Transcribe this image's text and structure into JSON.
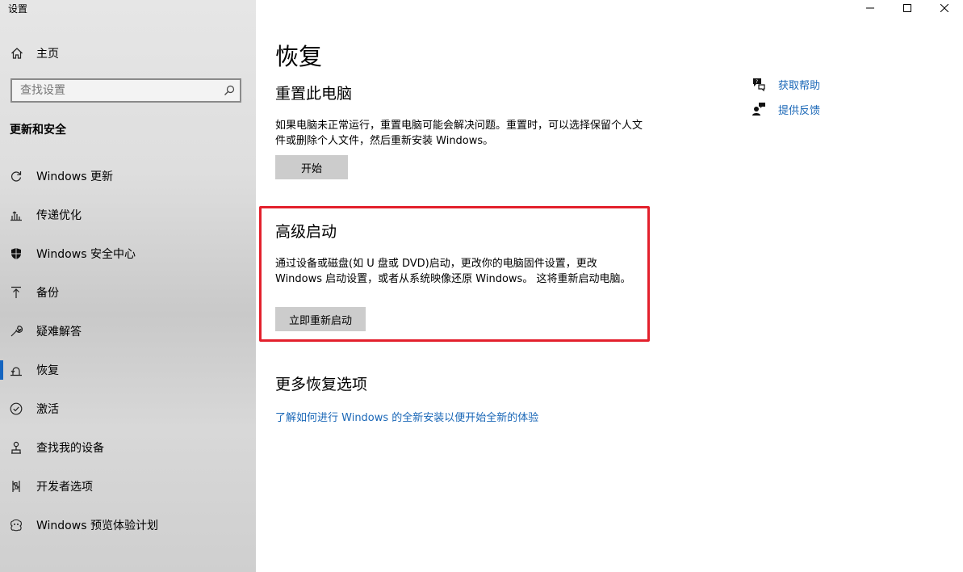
{
  "app_title": "设置",
  "window_controls": {
    "minimize": "—",
    "maximize": "☐",
    "close": "✕"
  },
  "sidebar": {
    "home_label": "主页",
    "search_placeholder": "查找设置",
    "section_title": "更新和安全",
    "items": [
      {
        "label": "Windows 更新",
        "icon": "refresh-icon",
        "active": false
      },
      {
        "label": "传递优化",
        "icon": "delivery-optimization-icon",
        "active": false
      },
      {
        "label": "Windows 安全中心",
        "icon": "shield-icon",
        "active": false
      },
      {
        "label": "备份",
        "icon": "backup-icon",
        "active": false
      },
      {
        "label": "疑难解答",
        "icon": "wrench-icon",
        "active": false
      },
      {
        "label": "恢复",
        "icon": "recovery-icon",
        "active": true
      },
      {
        "label": "激活",
        "icon": "check-circle-icon",
        "active": false
      },
      {
        "label": "查找我的设备",
        "icon": "find-device-icon",
        "active": false
      },
      {
        "label": "开发者选项",
        "icon": "developer-icon",
        "active": false
      },
      {
        "label": "Windows 预览体验计划",
        "icon": "insider-icon",
        "active": false
      }
    ]
  },
  "main": {
    "page_title": "恢复",
    "reset": {
      "heading": "重置此电脑",
      "description": "如果电脑未正常运行，重置电脑可能会解决问题。重置时，可以选择保留个人文件或删除个人文件，然后重新安装 Windows。",
      "button": "开始"
    },
    "advanced": {
      "heading": "高级启动",
      "description": "通过设备或磁盘(如 U 盘或 DVD)启动，更改你的电脑固件设置，更改 Windows 启动设置，或者从系统映像还原 Windows。 这将重新启动电脑。",
      "button": "立即重新启动"
    },
    "more": {
      "heading": "更多恢复选项",
      "link": "了解如何进行 Windows 的全新安装以便开始全新的体验"
    }
  },
  "help": {
    "get_help": "获取帮助",
    "feedback": "提供反馈"
  },
  "colors": {
    "accent": "#1565c0",
    "link": "#1a67b7",
    "highlight_frame": "#e3202c"
  }
}
